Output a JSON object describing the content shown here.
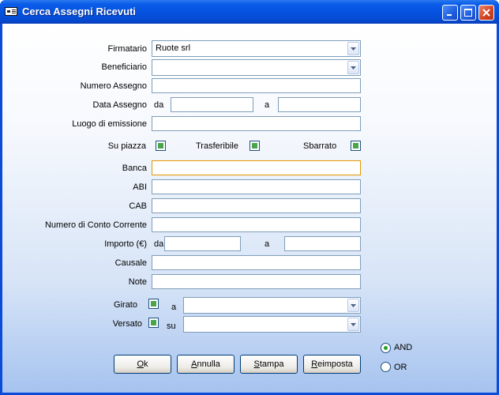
{
  "window": {
    "title": "Cerca Assegni Ricevuti"
  },
  "form": {
    "firmatario": {
      "label": "Firmatario",
      "value": "Ruote srl"
    },
    "beneficiario": {
      "label": "Beneficiario",
      "value": ""
    },
    "numero_assegno": {
      "label": "Numero Assegno",
      "value": ""
    },
    "data_assegno": {
      "label": "Data Assegno",
      "from_label": "da",
      "to_label": "a",
      "from_value": "",
      "to_value": ""
    },
    "luogo_emissione": {
      "label": "Luogo di emissione",
      "value": ""
    },
    "su_piazza": {
      "label": "Su piazza"
    },
    "trasferibile": {
      "label": "Trasferibile"
    },
    "sbarrato": {
      "label": "Sbarrato"
    },
    "banca": {
      "label": "Banca",
      "value": ""
    },
    "abi": {
      "label": "ABI",
      "value": ""
    },
    "cab": {
      "label": "CAB",
      "value": ""
    },
    "conto_corrente": {
      "label": "Numero di Conto Corrente",
      "value": ""
    },
    "importo": {
      "label": "Importo (€)",
      "from_label": "da",
      "to_label": "a",
      "from_value": "",
      "to_value": ""
    },
    "causale": {
      "label": "Causale",
      "value": ""
    },
    "note": {
      "label": "Note",
      "value": ""
    },
    "girato": {
      "label": "Girato",
      "target_label": "a",
      "value": ""
    },
    "versato": {
      "label": "Versato",
      "target_label": "su",
      "value": ""
    }
  },
  "buttons": {
    "ok": {
      "mnemonic": "O",
      "rest": "k"
    },
    "annulla": {
      "mnemonic": "A",
      "rest": "nnulla"
    },
    "stampa": {
      "mnemonic": "S",
      "rest": "tampa"
    },
    "reimposta": {
      "mnemonic": "R",
      "rest": "eimposta"
    }
  },
  "logic": {
    "and_label": "AND",
    "or_label": "OR",
    "selected": "AND"
  },
  "colors": {
    "titlebar": "#0553e0",
    "focus_border": "#e59700",
    "check_fill": "#4aa44a"
  }
}
